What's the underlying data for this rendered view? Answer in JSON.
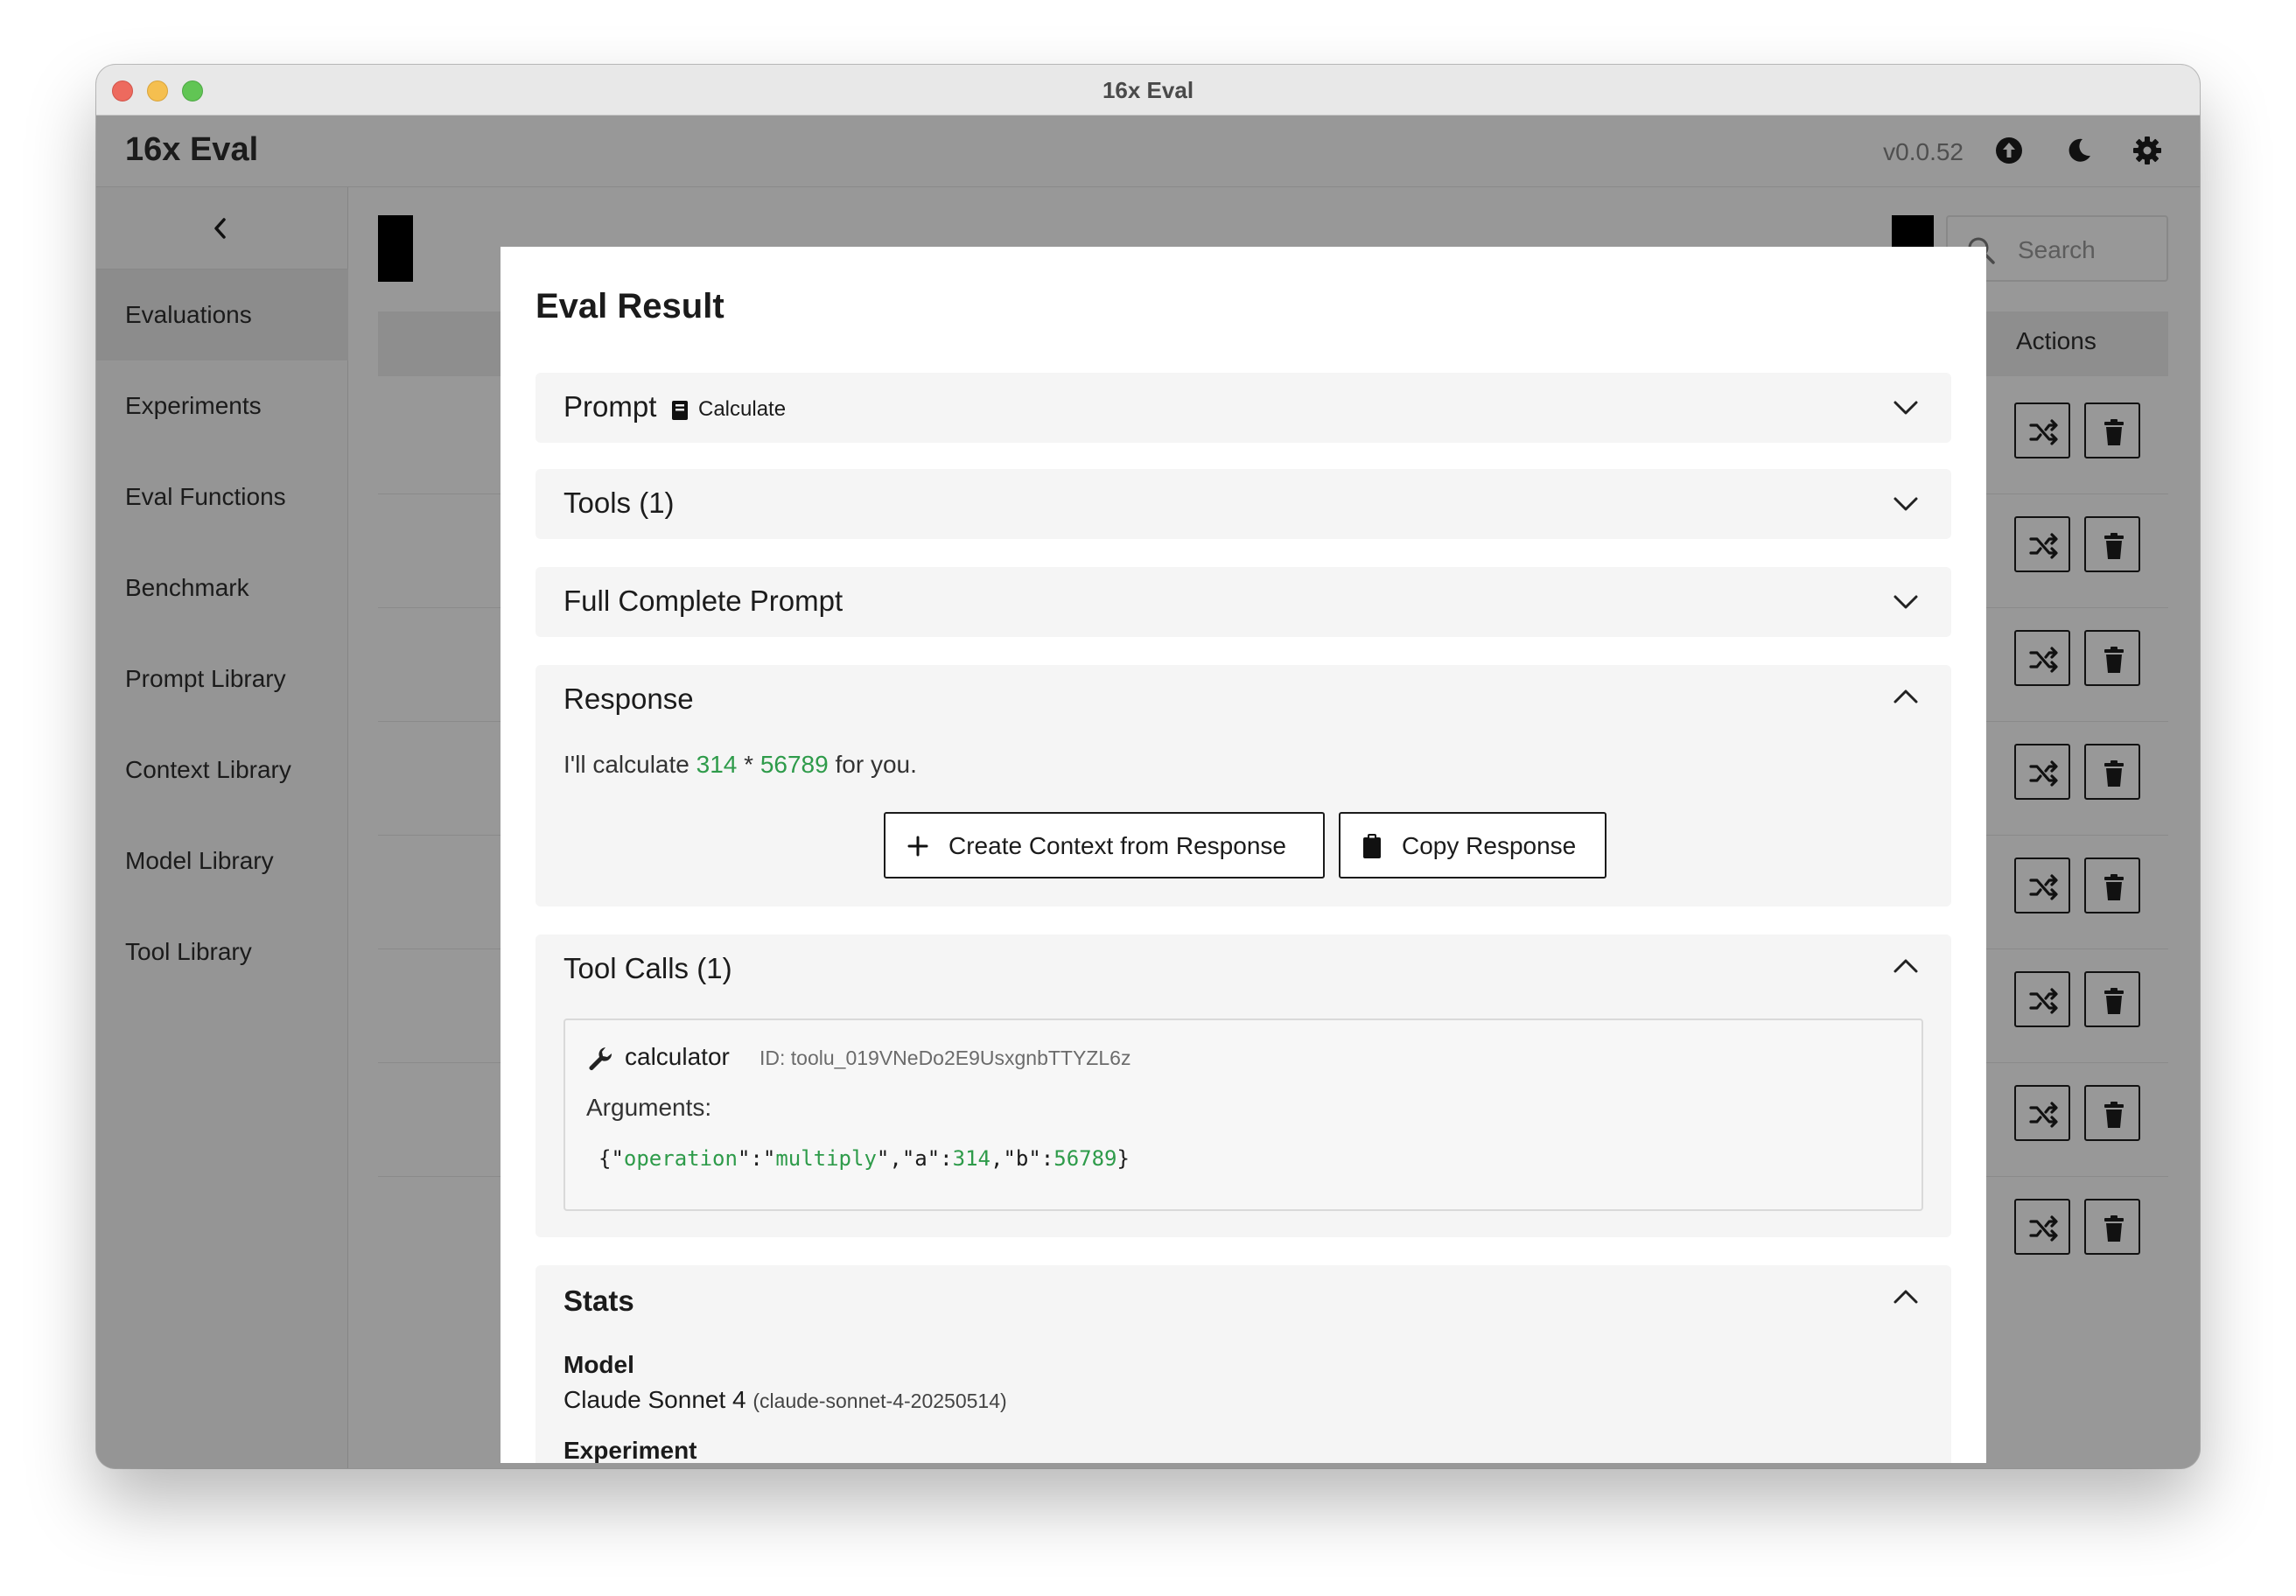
{
  "window": {
    "title": "16x Eval"
  },
  "header": {
    "app_name": "16x Eval",
    "version": "v0.0.52"
  },
  "sidebar": {
    "items": [
      {
        "label": "Evaluations",
        "active": true
      },
      {
        "label": "Experiments"
      },
      {
        "label": "Eval Functions"
      },
      {
        "label": "Benchmark"
      },
      {
        "label": "Prompt Library"
      },
      {
        "label": "Context Library"
      },
      {
        "label": "Model Library"
      },
      {
        "label": "Tool Library"
      }
    ]
  },
  "background": {
    "search_placeholder": "Search",
    "actions_header": "Actions",
    "row_count": 8
  },
  "modal": {
    "title": "Eval Result",
    "sections": {
      "prompt": {
        "title": "Prompt",
        "tag": "Calculate",
        "expanded": false
      },
      "tools": {
        "title": "Tools (1)",
        "expanded": false
      },
      "full_prompt": {
        "title": "Full Complete Prompt",
        "expanded": false
      },
      "response": {
        "title": "Response",
        "expanded": true,
        "text_prefix": "I'll calculate ",
        "num_a": "314",
        "operator": " * ",
        "num_b": "56789",
        "text_suffix": " for you.",
        "create_context_label": "Create Context from Response",
        "copy_label": "Copy Response"
      },
      "tool_calls": {
        "title": "Tool Calls (1)",
        "expanded": true,
        "tool_name": "calculator",
        "tool_id": "ID: toolu_019VNeDo2E9UsxgnbTTYZL6z",
        "arguments_label": "Arguments:",
        "arguments_json": "{\"operation\":\"multiply\",\"a\":314,\"b\":56789}"
      },
      "stats": {
        "title": "Stats",
        "expanded": true,
        "model_label": "Model",
        "model_name": "Claude Sonnet 4",
        "model_id": "(claude-sonnet-4-20250514)",
        "experiment_label": "Experiment"
      }
    }
  },
  "colors": {
    "accent_green": "#2e9b4a",
    "overlay_gray": "#989898",
    "panel_bg": "#f5f5f5"
  }
}
